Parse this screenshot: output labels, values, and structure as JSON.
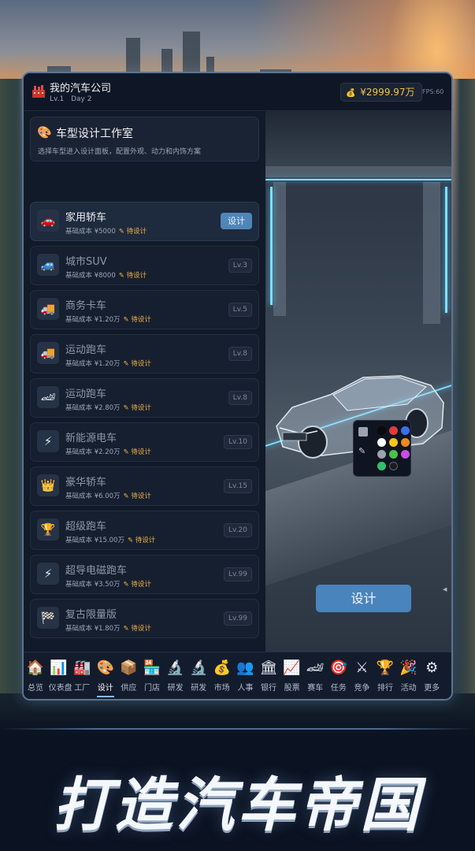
{
  "company": {
    "name": "我的汽车公司",
    "level": "Lv.1",
    "day": "Day 2",
    "money": "¥2999.97万",
    "fps": "FPS:60"
  },
  "studio": {
    "title": "车型设计工作室",
    "description": "选择车型进入设计面板，配置外观、动力和内饰方案"
  },
  "cars": [
    {
      "name": "家用轿车",
      "cost": "基础成本 ¥5000",
      "status": "待设计",
      "action": "设计",
      "icon": "sedan-icon",
      "glyph": "🚗"
    },
    {
      "name": "城市SUV",
      "cost": "基础成本 ¥8000",
      "status": "待设计",
      "level": "Lv.3",
      "icon": "suv-icon",
      "glyph": "🚙"
    },
    {
      "name": "商务卡车",
      "cost": "基础成本 ¥1.20万",
      "status": "待设计",
      "level": "Lv.5",
      "icon": "truck-icon",
      "glyph": "🚚"
    },
    {
      "name": "运动跑车",
      "cost": "基础成本 ¥1.20万",
      "status": "待设计",
      "level": "Lv.8",
      "icon": "truck-icon",
      "glyph": "🚚"
    },
    {
      "name": "运动跑车",
      "cost": "基础成本 ¥2.80万",
      "status": "待设计",
      "level": "Lv.8",
      "icon": "sports-car-icon",
      "glyph": "🏎"
    },
    {
      "name": "新能源电车",
      "cost": "基础成本 ¥2.20万",
      "status": "待设计",
      "level": "Lv.10",
      "icon": "lightning-icon",
      "glyph": "⚡"
    },
    {
      "name": "豪华轿车",
      "cost": "基础成本 ¥6.00万",
      "status": "待设计",
      "level": "Lv.15",
      "icon": "crown-icon",
      "glyph": "👑"
    },
    {
      "name": "超级跑车",
      "cost": "基础成本 ¥15.00万",
      "status": "待设计",
      "level": "Lv.20",
      "icon": "trophy-icon",
      "glyph": "🏆"
    },
    {
      "name": "超导电磁跑车",
      "cost": "基础成本 ¥3.50万",
      "status": "待设计",
      "level": "Lv.99",
      "icon": "lightning-icon",
      "glyph": "⚡"
    },
    {
      "name": "复古限量版",
      "cost": "基础成本 ¥1.80万",
      "status": "待设计",
      "level": "Lv.99",
      "icon": "checkered-flag-icon",
      "glyph": "🏁"
    }
  ],
  "view": {
    "design_button": "设计"
  },
  "palette_colors": [
    "#0a0a0a",
    "#e23b3b",
    "#3b6fe8",
    "#ffffff",
    "#f5c518",
    "#f08a1c",
    "#9aa3ad",
    "#4cc04c",
    "#c64fe0",
    "#34c070",
    "#1c1c1c"
  ],
  "nav": [
    {
      "label": "总览",
      "icon": "house-icon",
      "glyph": "🏠"
    },
    {
      "label": "仪表盘",
      "icon": "chart-icon",
      "glyph": "📊"
    },
    {
      "label": "工厂",
      "icon": "factory-icon",
      "glyph": "🏭"
    },
    {
      "label": "设计",
      "icon": "palette-icon",
      "glyph": "🎨",
      "active": true
    },
    {
      "label": "供应",
      "icon": "package-icon",
      "glyph": "📦"
    },
    {
      "label": "门店",
      "icon": "store-icon",
      "glyph": "🏪"
    },
    {
      "label": "研发",
      "icon": "microscope-icon",
      "glyph": "🔬"
    },
    {
      "label": "研发",
      "icon": "microscope-icon",
      "glyph": "🔬"
    },
    {
      "label": "市场",
      "icon": "money-bag-icon",
      "glyph": "💰"
    },
    {
      "label": "人事",
      "icon": "people-icon",
      "glyph": "👥"
    },
    {
      "label": "银行",
      "icon": "bank-icon",
      "glyph": "🏛"
    },
    {
      "label": "股票",
      "icon": "stock-chart-icon",
      "glyph": "📈"
    },
    {
      "label": "赛车",
      "icon": "race-car-icon",
      "glyph": "🏎"
    },
    {
      "label": "任务",
      "icon": "target-icon",
      "glyph": "🎯"
    },
    {
      "label": "竞争",
      "icon": "swords-icon",
      "glyph": "⚔"
    },
    {
      "label": "排行",
      "icon": "trophy-icon",
      "glyph": "🏆"
    },
    {
      "label": "活动",
      "icon": "celebration-icon",
      "glyph": "🎉"
    },
    {
      "label": "更多",
      "icon": "gear-icon",
      "glyph": "⚙"
    }
  ],
  "slogan": "打造汽车帝国"
}
